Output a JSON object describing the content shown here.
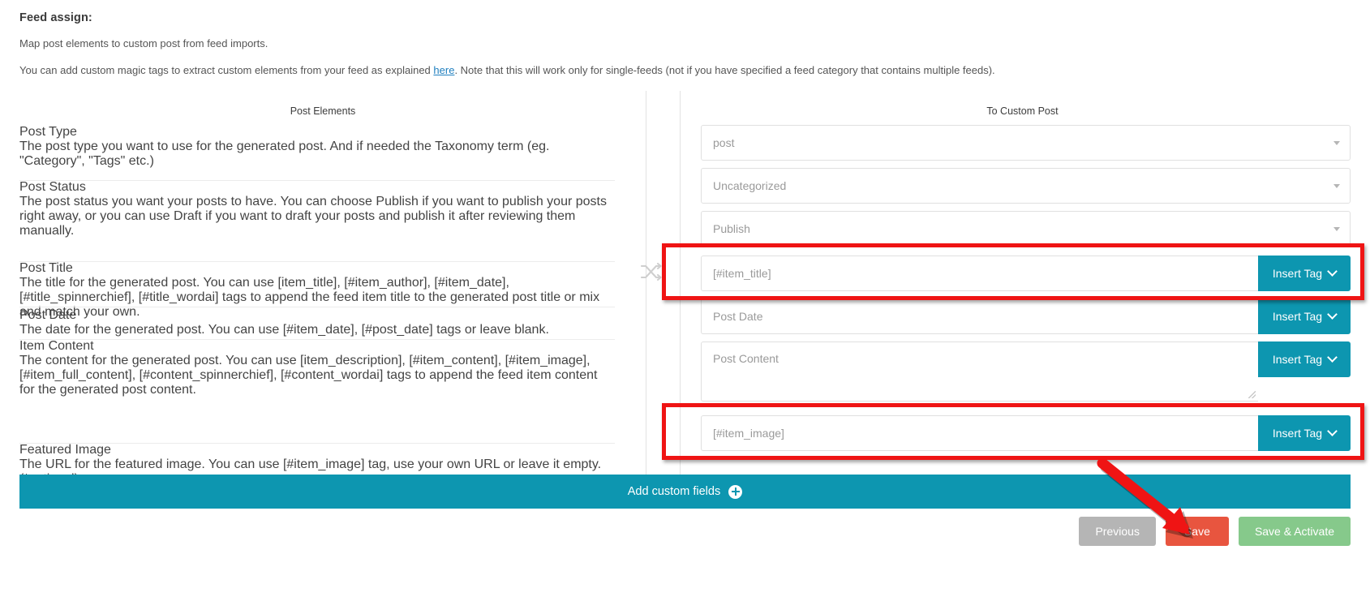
{
  "header": {
    "title": "Feed assign:",
    "subtitle": "Map post elements to custom post from feed imports.",
    "note_before": "You can add custom magic tags to extract custom elements from your feed as explained ",
    "note_link": "here",
    "note_after": ". Note that this will work only for single-feeds (not if you have specified a feed category that contains multiple feeds)."
  },
  "columns": {
    "left_header": "Post Elements",
    "right_header": "To Custom Post"
  },
  "rows": [
    {
      "key": "post_type",
      "label": "Post Type",
      "description": "The post type you want to use for the generated post. And if needed the Taxonomy term (eg. \"Category\", \"Tags\" etc.)"
    },
    {
      "key": "post_status",
      "label": "Post Status",
      "description": "The post status you want your posts to have. You can choose Publish if you want to publish your posts right away, or you can use Draft if you want to draft your posts and publish it after reviewing them manually."
    },
    {
      "key": "post_title",
      "label": "Post Title",
      "description": "The title for the generated post. You can use [item_title], [#item_author], [#item_date], [#title_spinnerchief], [#title_wordai] tags to append the feed item title to the generated post title or mix and match your own."
    },
    {
      "key": "post_date",
      "label": "Post Date",
      "description": "The date for the generated post. You can use [#item_date], [#post_date] tags or leave blank."
    },
    {
      "key": "item_content",
      "label": "Item Content",
      "description": "The content for the generated post. You can use [item_description], [#item_content], [#item_image], [#item_full_content], [#content_spinnerchief], [#content_wordai] tags to append the feed item content for the generated post content."
    },
    {
      "key": "featured_image",
      "label": "Featured Image",
      "description": "The URL for the featured image. You can use [#item_image] tag, use your own URL or leave it empty. (*optional)"
    }
  ],
  "controls": {
    "post_type": {
      "value": "post",
      "type": "select"
    },
    "taxonomy": {
      "value": "Uncategorized",
      "type": "select"
    },
    "post_status": {
      "value": "Publish",
      "type": "select"
    },
    "post_title": {
      "value": "[#item_title]",
      "placeholder": "[#item_title]",
      "type": "text",
      "button": "Insert Tag",
      "highlighted": true
    },
    "post_date": {
      "value": "Post Date",
      "placeholder": "Post Date",
      "type": "text",
      "button": "Insert Tag",
      "highlighted": false
    },
    "post_content": {
      "value": "Post Content",
      "placeholder": "Post Content",
      "type": "textarea",
      "button": "Insert Tag",
      "highlighted": false
    },
    "featured_image": {
      "value": "[#item_image]",
      "placeholder": "[#item_image]",
      "type": "text",
      "button": "Insert Tag",
      "highlighted": true
    }
  },
  "add_custom_fields": {
    "label": "Add custom fields",
    "icon": "plus-circle-icon"
  },
  "footer": {
    "previous": "Previous",
    "save": "Save",
    "save_activate": "Save & Activate"
  },
  "annotations": {
    "highlight_color": "#ef1414",
    "arrow_color": "#ef1414",
    "accent_color": "#0d96b0",
    "save_color": "#e8553f",
    "activate_color": "#86c98b"
  }
}
